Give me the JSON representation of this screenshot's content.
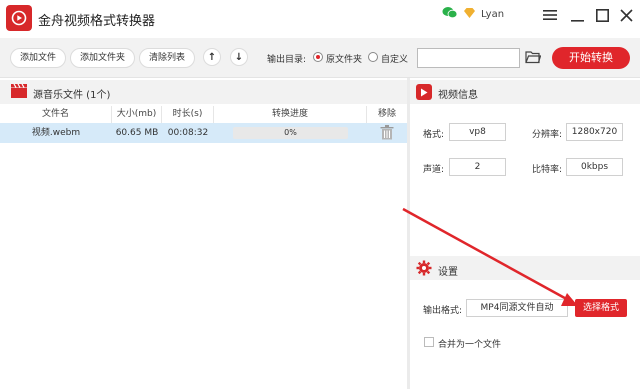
{
  "app": {
    "title": "金舟视频格式转换器",
    "user_name": "Lyan"
  },
  "toolbar": {
    "add_file": "添加文件",
    "add_folder": "添加文件夹",
    "clear_list": "清除列表",
    "move_up": "↑",
    "move_down": "↓",
    "output_dir_label": "输出目录:",
    "option_source_folder": "原文件夹",
    "option_custom": "自定义",
    "output_path_value": "",
    "start_button": "开始转换"
  },
  "file_list": {
    "title": "源音乐文件 (1个)",
    "columns": [
      "文件名",
      "大小(mb)",
      "时长(s)",
      "转换进度",
      "移除"
    ],
    "rows": [
      {
        "name": "视频.webm",
        "size": "60.65 MB",
        "duration": "00:08:32",
        "progress": "0%",
        "progress_value": 0
      }
    ]
  },
  "video_info": {
    "title": "视频信息",
    "format_label": "格式:",
    "format_value": "vp8",
    "resolution_label": "分辨率:",
    "resolution_value": "1280x720",
    "channels_label": "声道:",
    "channels_value": "2",
    "bitrate_label": "比特率:",
    "bitrate_value": "0kbps"
  },
  "settings": {
    "title": "设置",
    "output_format_label": "输出格式:",
    "output_format_value": "MP4同源文件自动",
    "select_format_button": "选择格式",
    "merge_label": "合并为一个文件",
    "merge_checked": false
  },
  "colors": {
    "brand_red": "#e0262b",
    "row_highlight": "#d6eaf9",
    "panel_gray": "#f2f2f2"
  },
  "icons": {
    "logo": "play-logo-icon",
    "wechat": "wechat-icon",
    "vip": "vip-diamond-icon",
    "menu": "hamburger-menu-icon",
    "minimize": "minimize-icon",
    "maximize": "maximize-icon",
    "close": "close-icon",
    "folder": "folder-open-icon",
    "film": "film-clapper-icon",
    "trash": "trash-icon",
    "video_info": "play-icon",
    "settings": "gear-icon"
  }
}
